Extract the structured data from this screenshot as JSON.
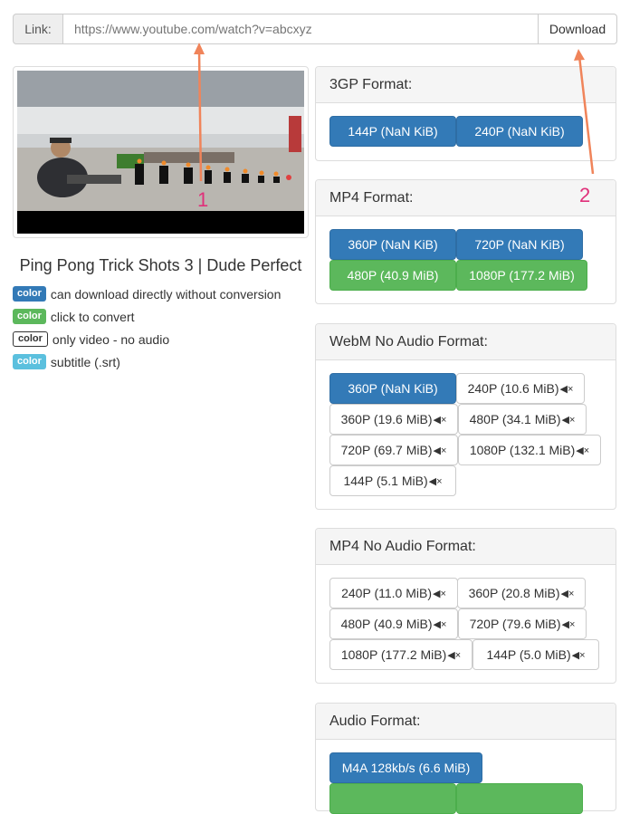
{
  "link": {
    "label": "Link:",
    "placeholder": "https://www.youtube.com/watch?v=abcxyz",
    "button": "Download"
  },
  "video": {
    "title": "Ping Pong Trick Shots 3 | Dude Perfect"
  },
  "legend": [
    {
      "badge": "color",
      "text": "can download directly without conversion"
    },
    {
      "badge": "color",
      "text": "click to convert"
    },
    {
      "badge": "color",
      "text": "only video - no audio"
    },
    {
      "badge": "color",
      "text": "subtitle (.srt)"
    }
  ],
  "panels": {
    "gp3": {
      "title": "3GP Format:",
      "buttons": [
        "144P (NaN KiB)",
        "240P (NaN KiB)"
      ]
    },
    "mp4": {
      "title": "MP4 Format:",
      "buttons": [
        "360P (NaN KiB)",
        "720P (NaN KiB)",
        "480P (40.9 MiB)",
        "1080P (177.2 MiB)"
      ]
    },
    "webm": {
      "title": "WebM No Audio Format:",
      "buttons": [
        "360P (NaN KiB)",
        "240P (10.6 MiB)",
        "360P (19.6 MiB)",
        "480P (34.1 MiB)",
        "720P (69.7 MiB)",
        "1080P (132.1 MiB)",
        "144P (5.1 MiB)"
      ]
    },
    "mp4na": {
      "title": "MP4 No Audio Format:",
      "buttons": [
        "240P (11.0 MiB)",
        "360P (20.8 MiB)",
        "480P (40.9 MiB)",
        "720P (79.6 MiB)",
        "1080P (177.2 MiB)",
        "144P (5.0 MiB)"
      ]
    },
    "audio": {
      "title": "Audio Format:",
      "buttons": [
        "M4A 128kb/s (6.6 MiB)"
      ]
    }
  },
  "annotations": [
    "1",
    "2"
  ],
  "colors": {
    "primary": "#337ab7",
    "success": "#5cb85c",
    "info": "#5bc0de",
    "annotation_arrow": "#f0845a",
    "annotation_number": "#e0307a"
  }
}
